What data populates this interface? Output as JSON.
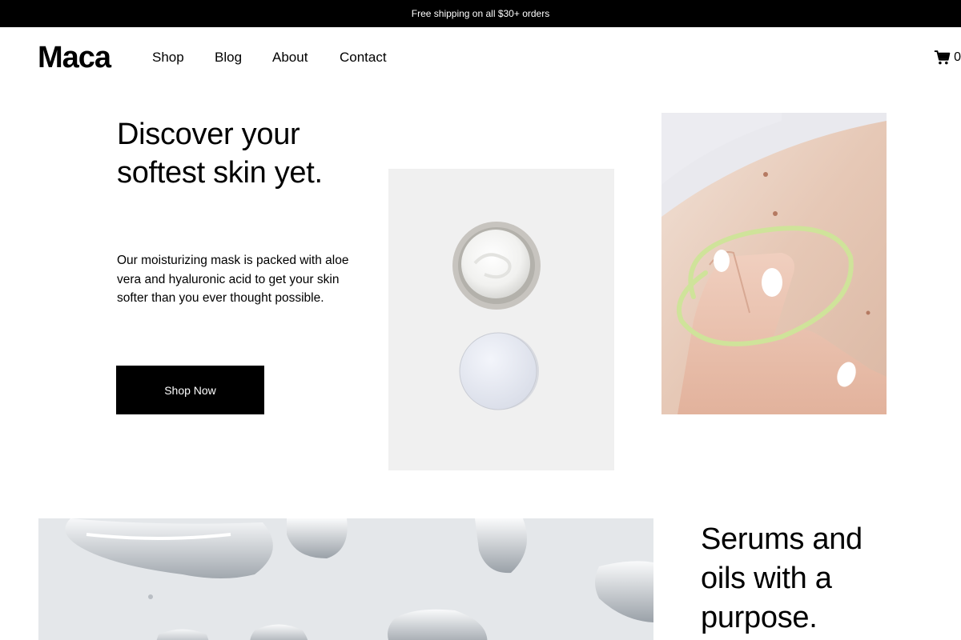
{
  "announcement": "Free shipping on all $30+ orders",
  "brand": "Maca",
  "nav": [
    "Shop",
    "Blog",
    "About",
    "Contact"
  ],
  "cart": {
    "icon": "cart-icon",
    "count": "0"
  },
  "hero": {
    "title": "Discover your softest skin yet.",
    "body": "Our moisturizing mask is packed with aloe vera and hyaluronic acid to get your skin softer than you ever thought possible.",
    "cta": "Shop Now"
  },
  "section2": {
    "title": "Serums and oils with a purpose."
  },
  "colors": {
    "accent": "#000000",
    "highlight": "#cfe39a",
    "card_bg": "#f0f0f0"
  }
}
